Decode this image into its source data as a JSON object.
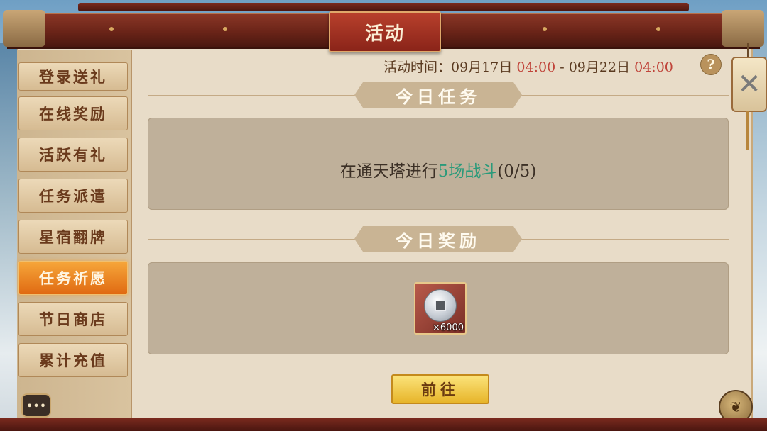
{
  "window": {
    "title": "活动"
  },
  "sidebar": {
    "items": [
      {
        "label": "登录送礼"
      },
      {
        "label": "在线奖励"
      },
      {
        "label": "活跃有礼"
      },
      {
        "label": "任务派遣"
      },
      {
        "label": "星宿翻牌"
      },
      {
        "label": "任务祈愿",
        "active": true
      },
      {
        "label": "节日商店"
      },
      {
        "label": "累计充值"
      }
    ],
    "menu_icon": "ellipsis-icon"
  },
  "event_time": {
    "label": "活动时间：",
    "start_date": "09月17日",
    "start_time": "04:00",
    "separator": "-",
    "end_date": "09月22日",
    "end_time": "04:00"
  },
  "help": {
    "symbol": "?"
  },
  "today_task": {
    "heading": "今日任务",
    "text_prefix": "在通天塔进行",
    "text_highlight": "5场战斗",
    "progress": "(0/5)"
  },
  "today_reward": {
    "heading": "今日奖励",
    "items": [
      {
        "icon": "copper-coin-icon",
        "quantity": "×6000"
      }
    ]
  },
  "go_button": {
    "label": "前往"
  },
  "close": {
    "symbol": "✕"
  },
  "colors": {
    "highlight": "#2a9a7a",
    "time_red": "#c0443a",
    "active_tab": "#e88a22"
  }
}
